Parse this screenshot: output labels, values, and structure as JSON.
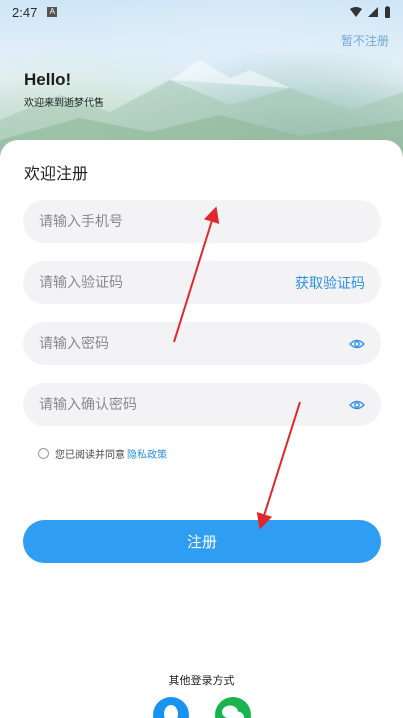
{
  "status": {
    "time": "2:47",
    "a_badge": "A"
  },
  "header": {
    "skip_label": "暂不注册",
    "hello": "Hello!",
    "welcome": "欢迎来到逝梦代售"
  },
  "form": {
    "title": "欢迎注册",
    "phone_placeholder": "请输入手机号",
    "code_placeholder": "请输入验证码",
    "get_code_label": "获取验证码",
    "password_placeholder": "请输入密码",
    "confirm_placeholder": "请输入确认密码",
    "agree_text": "您已阅读并同意",
    "policy_label": "隐私政策",
    "submit_label": "注册"
  },
  "footer": {
    "other_login_label": "其他登录方式"
  },
  "colors": {
    "accent": "#2f9ef2",
    "link": "#2e8fe8",
    "field_bg": "#f3f3f5",
    "wechat": "#19b44d",
    "qq": "#1a93f0",
    "annotation": "#e0282c"
  },
  "icons": [
    "wifi-icon",
    "signal-icon",
    "battery-icon",
    "eye-icon",
    "qq-icon",
    "wechat-icon"
  ]
}
